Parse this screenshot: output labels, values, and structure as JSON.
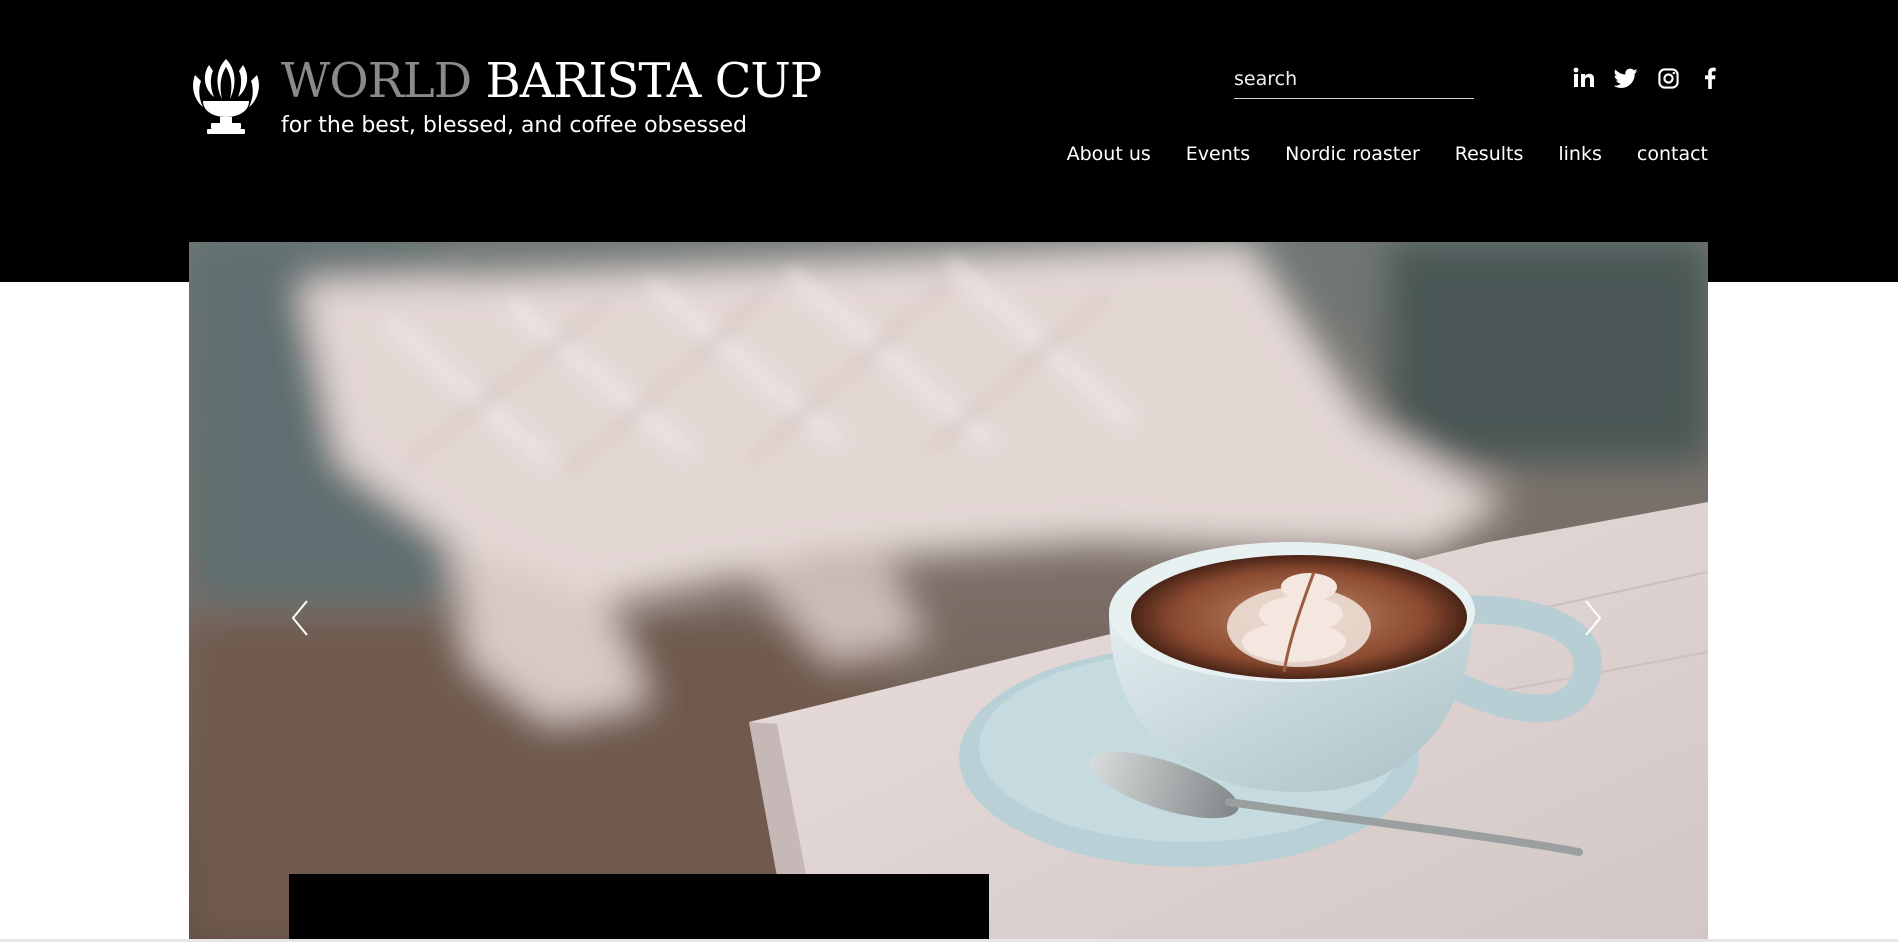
{
  "brand": {
    "title_part1": "WORLD",
    "title_part2": "BARISTA CUP",
    "tagline": "for the best, blessed, and coffee obsessed",
    "logo_icon": "coffee-trophy-icon"
  },
  "search": {
    "placeholder": "search",
    "value": ""
  },
  "socials": [
    {
      "name": "linkedin-icon"
    },
    {
      "name": "twitter-icon"
    },
    {
      "name": "instagram-icon"
    },
    {
      "name": "facebook-icon"
    }
  ],
  "nav": {
    "items": [
      {
        "label": "About us"
      },
      {
        "label": "Events"
      },
      {
        "label": "Nordic roaster"
      },
      {
        "label": "Results"
      },
      {
        "label": "links"
      },
      {
        "label": "contact"
      }
    ]
  },
  "hero": {
    "image": "latte-art-cup-on-table",
    "prev_icon": "chevron-left-icon",
    "next_icon": "chevron-right-icon"
  },
  "colors": {
    "header_bg": "#000000",
    "page_bg": "#ffffff",
    "brand_world": "#8a8a8a",
    "text_light": "#ffffff"
  }
}
